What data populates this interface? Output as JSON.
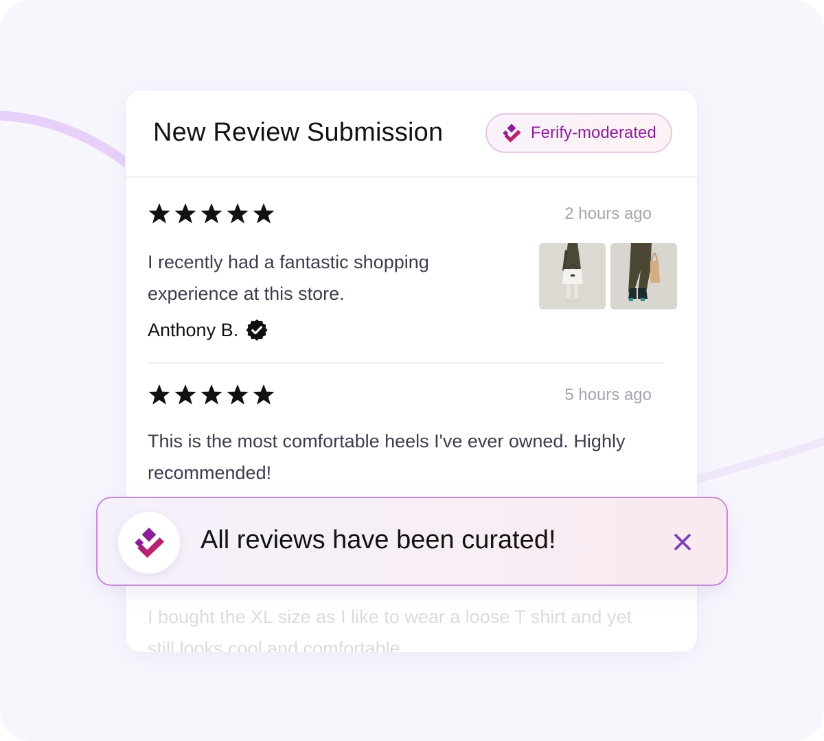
{
  "card": {
    "title": "New Review Submission",
    "badge": {
      "label": "Ferify-moderated",
      "icon": "ferify-logo-icon"
    }
  },
  "reviews": [
    {
      "rating": 5,
      "time": "2 hours ago",
      "text_line1": "I recently had a fantastic shopping",
      "text_line2": "experience at this store.",
      "author": "Anthony B.",
      "verified": true,
      "photos": [
        "outfit-photo-white-bag",
        "outfit-photo-tan-bag"
      ]
    },
    {
      "rating": 5,
      "time": "5 hours ago",
      "text_line1": "This is the most comfortable heels I've ever owned. Highly",
      "text_line2": "recommended!"
    },
    {
      "text_line1": "I bought the XL size as I like to wear a loose T shirt and yet",
      "text_line2": "still looks cool and comfortable"
    }
  ],
  "toast": {
    "message": "All reviews have been curated!",
    "icon": "ferify-logo-icon",
    "close_icon": "close-icon"
  },
  "colors": {
    "brand_purple": "#8c1f9a",
    "brand_red": "#e0244a",
    "accent_violet": "#7c3ab8",
    "background": "#f7f6fd"
  }
}
